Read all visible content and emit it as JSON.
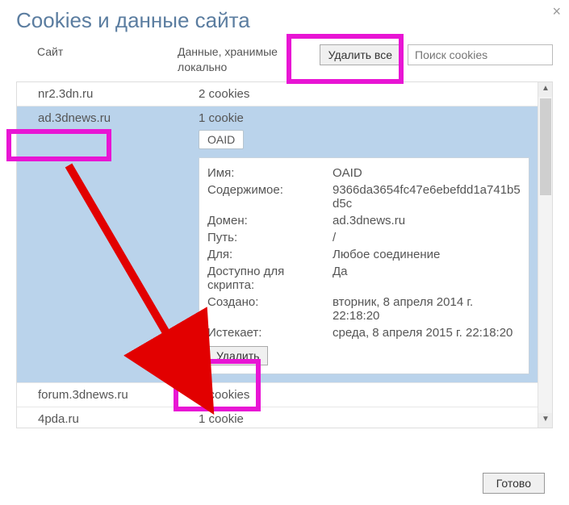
{
  "dialog": {
    "title": "Cookies и данные сайта",
    "close_glyph": "×"
  },
  "columns": {
    "site": "Сайт",
    "data": "Данные, хранимые локально"
  },
  "controls": {
    "delete_all": "Удалить все",
    "search_placeholder": "Поиск cookies",
    "done": "Готово"
  },
  "rows": {
    "r0": {
      "site": "nr2.3dn.ru",
      "data": "2 cookies"
    },
    "r1": {
      "site": "ad.3dnews.ru",
      "data": "1 cookie"
    },
    "r2": {
      "site": "forum.3dnews.ru",
      "data": "2 cookies"
    },
    "r3": {
      "site": "4pda.ru",
      "data": "1 cookie"
    }
  },
  "cookie_chip": "OAID",
  "detail": {
    "name_k": "Имя:",
    "name_v": "OAID",
    "content_k": "Содержимое:",
    "content_v": "9366da3654fc47e6ebefdd1a741b5d5c",
    "domain_k": "Домен:",
    "domain_v": "ad.3dnews.ru",
    "path_k": "Путь:",
    "path_v": "/",
    "for_k": "Для:",
    "for_v": "Любое соединение",
    "script_k": "Доступно для скрипта:",
    "script_v": "Да",
    "created_k": "Создано:",
    "created_v": "вторник, 8 апреля 2014 г. 22:18:20",
    "expires_k": "Истекает:",
    "expires_v": "среда, 8 апреля 2015 г. 22:18:20",
    "delete": "Удалить",
    "close_glyph": "×"
  },
  "scrollbar": {
    "up": "▲",
    "down": "▼"
  }
}
